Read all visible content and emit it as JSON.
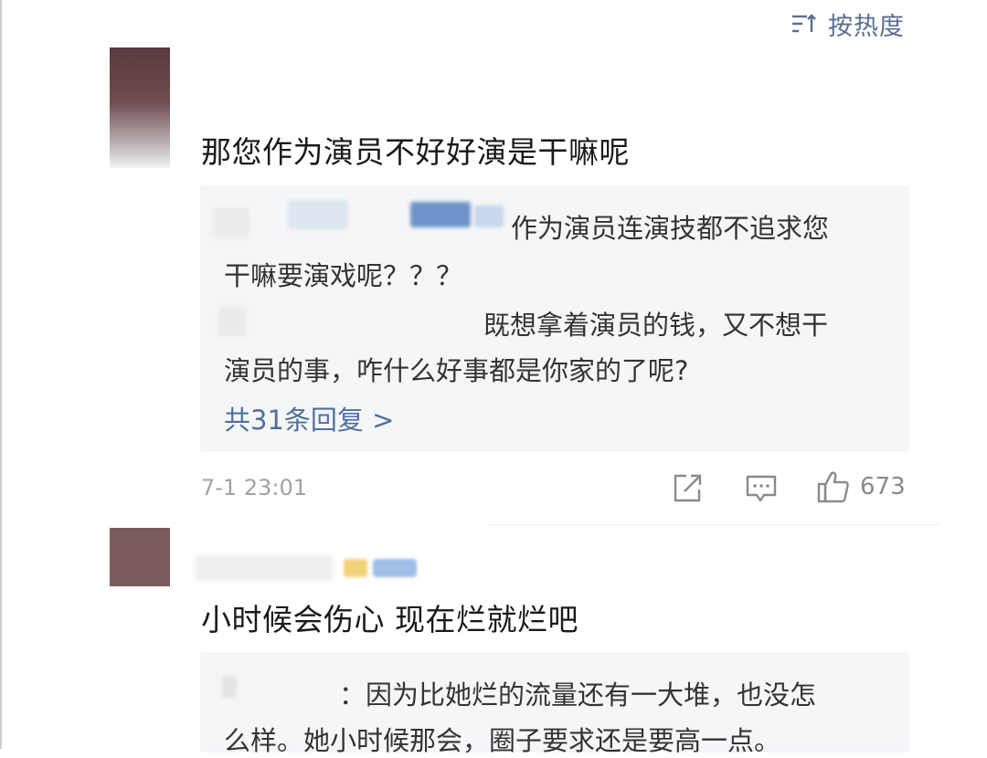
{
  "sort": {
    "label": "按热度",
    "icon": "sort-lines-icon"
  },
  "comments": [
    {
      "avatar": "avatar-blurred",
      "text": "那您作为演员不好好演是干嘛呢",
      "replies": {
        "lines": [
          "作为演员连演技都不追求您",
          "干嘛要演戏呢？？？",
          "既想拿着演员的钱，又不想干",
          "演员的事，咋什么好事都是你家的了呢?"
        ],
        "more": "共31条回复 >"
      },
      "time": "7-1 23:01",
      "actions": {
        "share_icon": "share-icon",
        "comment_icon": "comment-icon",
        "like_icon": "thumbs-up-icon",
        "like_count": "673"
      }
    },
    {
      "avatar": "avatar-blurred",
      "text": "小时候会伤心 现在烂就烂吧",
      "replies": {
        "lines": [
          "：因为比她烂的流量还有一大堆，也没怎",
          "么样。她小时候那会，圈子要求还是要高一点。"
        ]
      }
    }
  ],
  "colors": {
    "link_blue": "#51709e",
    "panel_bg": "#f5f6f8",
    "meta_gray": "#a2a2a2"
  }
}
